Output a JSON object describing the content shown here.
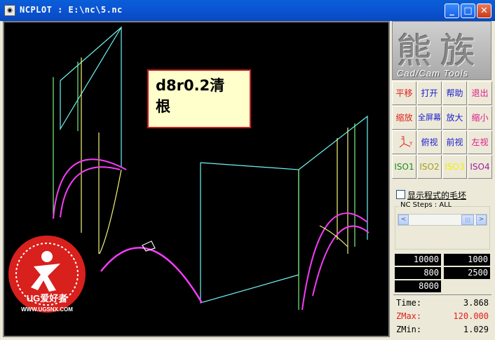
{
  "window": {
    "title": "NCPLOT : E:\\nc\\5.nc",
    "app_icon": "cat-icon",
    "controls": {
      "minimize": "_",
      "maximize": "□",
      "close": "✕"
    }
  },
  "viewport": {
    "note_line1": "d8r0.2清",
    "note_line2": "根",
    "watermark_brand": "UG爱好者",
    "watermark_url": "WWW.UGSNX.COM",
    "colors": {
      "cyan": "#6ff4f4",
      "magenta": "#f63cf6",
      "yellow": "#f4f47c",
      "green": "#7cf47c",
      "background": "#000000"
    }
  },
  "panel": {
    "brand_big": "熊族",
    "brand_sub": "Cad/Cam Tools",
    "buttons": [
      {
        "label": "平移",
        "color": "#e0201c"
      },
      {
        "label": "打开",
        "color": "#1c20d0"
      },
      {
        "label": "帮助",
        "color": "#1c20d0"
      },
      {
        "label": "退出",
        "color": "#e01c8c"
      },
      {
        "label": "缩放",
        "color": "#e0201c"
      },
      {
        "label": "全屏幕",
        "color": "#1c20d0"
      },
      {
        "label": "放大",
        "color": "#1c20d0"
      },
      {
        "label": "缩小",
        "color": "#e01c8c"
      },
      {
        "label": "axis-icon",
        "color": "#e0201c"
      },
      {
        "label": "俯视",
        "color": "#1c20d0"
      },
      {
        "label": "前视",
        "color": "#1c20d0"
      },
      {
        "label": "左视",
        "color": "#e01c8c"
      },
      {
        "label": "ISO1",
        "color": "#1c8c1c"
      },
      {
        "label": "ISO2",
        "color": "#a0a01c"
      },
      {
        "label": "ISO3",
        "color": "#f0f000"
      },
      {
        "label": "ISO4",
        "color": "#a01ca0"
      }
    ],
    "show_stock_label": "显示程式的毛坯",
    "nc_steps_label": "NC Steps : ALL",
    "scroll_left": "<",
    "scroll_right": ">",
    "numbers": [
      "10000",
      "1000",
      "800",
      "2500",
      "8000"
    ],
    "stats": [
      {
        "key": "Time:",
        "value": "3.868",
        "color": "#000000"
      },
      {
        "key": "ZMax:",
        "value": "120.000",
        "color": "#e0201c"
      },
      {
        "key": "ZMin:",
        "value": "1.029",
        "color": "#000000"
      }
    ]
  }
}
